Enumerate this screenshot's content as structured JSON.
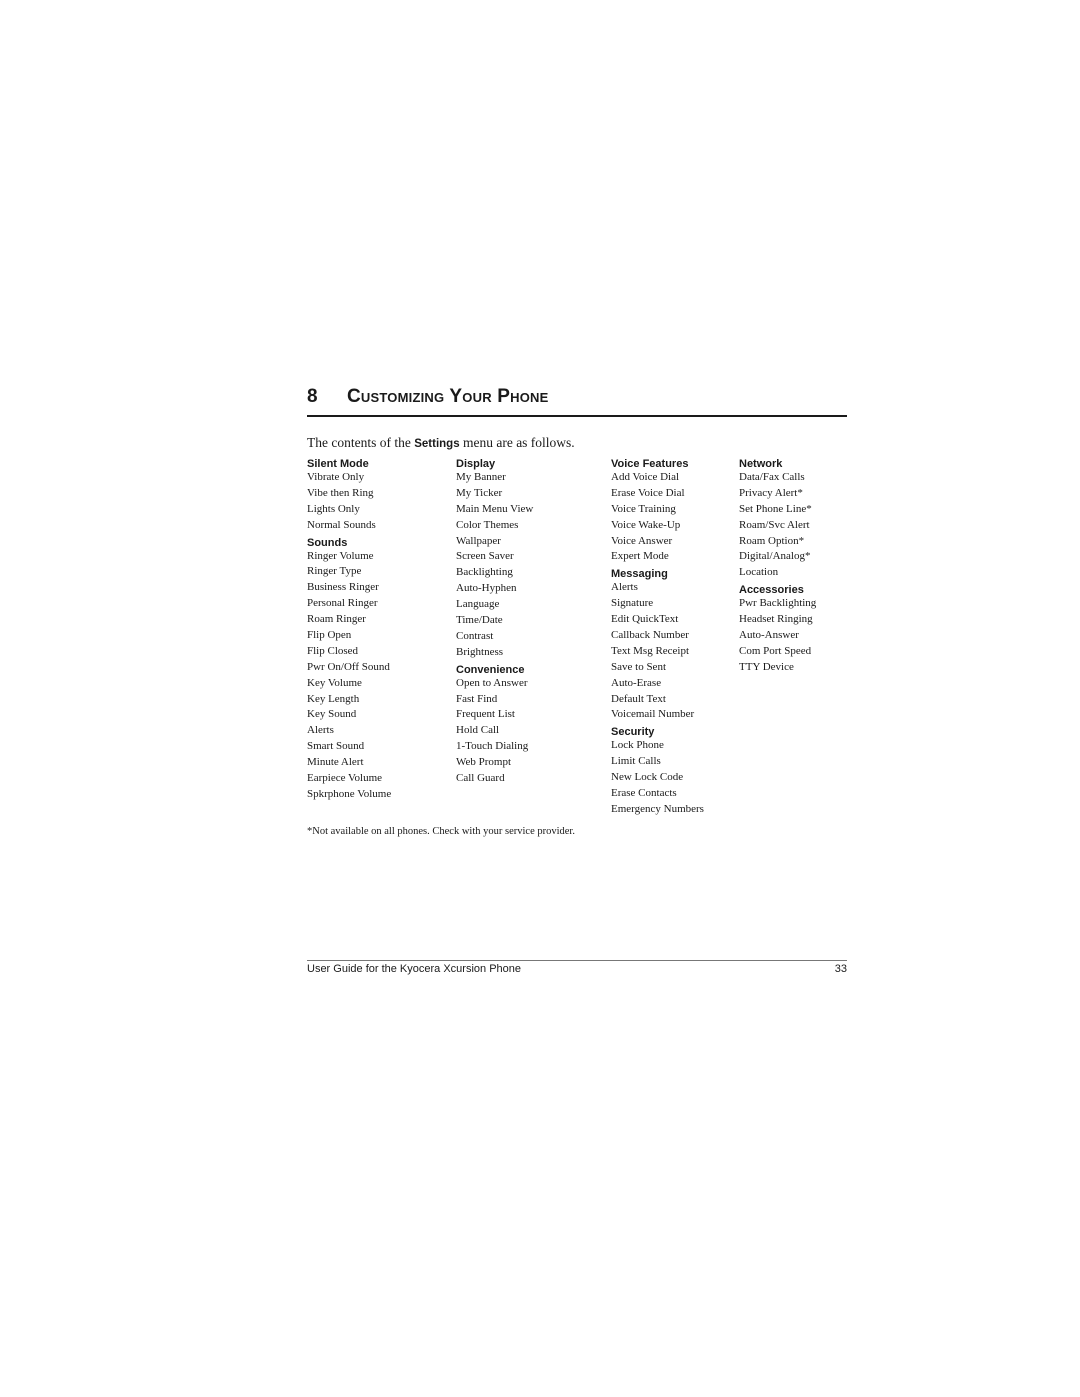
{
  "chapter": {
    "number": "8",
    "title": "Customizing Your Phone"
  },
  "intro": {
    "before": "The contents of the ",
    "keyword": "Settings",
    "after": " menu are as follows."
  },
  "columns": [
    {
      "sections": [
        {
          "heading": "Silent Mode",
          "items": [
            "Vibrate Only",
            "Vibe then Ring",
            "Lights Only",
            "Normal Sounds"
          ]
        },
        {
          "heading": "Sounds",
          "items": [
            "Ringer Volume",
            "Ringer Type",
            "Business Ringer",
            "Personal Ringer",
            "Roam Ringer",
            "Flip Open",
            "Flip Closed",
            "Pwr On/Off Sound",
            "Key Volume",
            "Key Length",
            "Key Sound",
            "Alerts",
            "Smart Sound",
            "Minute Alert",
            "Earpiece Volume",
            "Spkrphone Volume"
          ]
        }
      ]
    },
    {
      "sections": [
        {
          "heading": "Display",
          "items": [
            "My Banner",
            "My Ticker",
            "Main Menu View",
            "Color Themes",
            "Wallpaper",
            "Screen Saver",
            "Backlighting",
            "Auto-Hyphen",
            "Language",
            "Time/Date",
            "Contrast",
            "Brightness"
          ]
        },
        {
          "heading": "Convenience",
          "items": [
            "Open to Answer",
            "Fast Find",
            "Frequent List",
            "Hold Call",
            "1-Touch Dialing",
            "Web Prompt",
            "Call Guard"
          ]
        }
      ]
    },
    {
      "sections": [
        {
          "heading": "Voice Features",
          "items": [
            "Add Voice Dial",
            "Erase Voice Dial",
            "Voice Training",
            "Voice Wake-Up",
            "Voice Answer",
            "Expert Mode"
          ]
        },
        {
          "heading": "Messaging",
          "items": [
            "Alerts",
            "Signature",
            "Edit QuickText",
            "Callback Number",
            "Text Msg Receipt",
            "Save to Sent",
            "Auto-Erase",
            "Default Text",
            "Voicemail Number"
          ]
        },
        {
          "heading": "Security",
          "items": [
            "Lock Phone",
            "Limit Calls",
            "New Lock Code",
            "Erase Contacts",
            "Emergency Numbers"
          ]
        }
      ]
    },
    {
      "sections": [
        {
          "heading": "Network",
          "items": [
            "Data/Fax Calls",
            "Privacy Alert*",
            "Set Phone Line*",
            "Roam/Svc Alert",
            "Roam Option*",
            "Digital/Analog*",
            "Location"
          ]
        },
        {
          "heading": "Accessories",
          "items": [
            "Pwr Backlighting",
            "Headset Ringing",
            "Auto-Answer",
            "Com Port Speed",
            "TTY Device"
          ]
        }
      ]
    }
  ],
  "footnote": "*Not available on all phones. Check with your service provider.",
  "footer": {
    "text": "User Guide for the Kyocera Xcursion Phone",
    "page_number": "33"
  }
}
